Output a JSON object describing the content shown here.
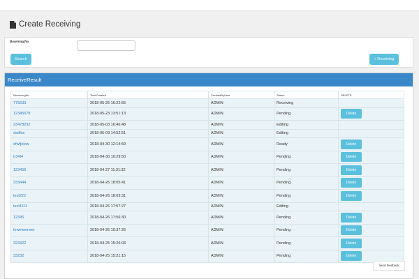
{
  "page": {
    "title": "Create Receiving",
    "icon": "document-icon"
  },
  "search": {
    "field_label": "ReceivingNo",
    "field_value": "",
    "search_label": "Search",
    "add_label": "+ Receiving"
  },
  "results": {
    "heading": "ReceiveResult",
    "columns": [
      "ReceivingNo",
      "TimeCreated",
      "CreatedByUser",
      "Status",
      "DELETE"
    ],
    "delete_label": "Delete",
    "rows": [
      {
        "receiving_no": "775633",
        "time_created": "2018-05-25 16:22:55",
        "created_by": "ADMIN",
        "status": "Receiving",
        "deletable": false
      },
      {
        "receiving_no": "12345678",
        "time_created": "2018-05-23 13:51:13",
        "created_by": "ADMIN",
        "status": "Pending",
        "deletable": true
      },
      {
        "receiving_no": "23478292",
        "time_created": "2018-05-03 16:46:48",
        "created_by": "ADMIN",
        "status": "Editing",
        "deletable": false
      },
      {
        "receiving_no": "dsdfds",
        "time_created": "2018-05-03 14:52:51",
        "created_by": "ADMIN",
        "status": "Editing",
        "deletable": false
      },
      {
        "receiving_no": "efwfjoiow",
        "time_created": "2018-04-30 12:14:59",
        "created_by": "ADMIN",
        "status": "Ready",
        "deletable": true
      },
      {
        "receiving_no": "tr34t4",
        "time_created": "2018-04-30 10:29:50",
        "created_by": "ADMIN",
        "status": "Pending",
        "deletable": true
      },
      {
        "receiving_no": "123456",
        "time_created": "2018-04-27 11:31:32",
        "created_by": "ADMIN",
        "status": "Pending",
        "deletable": true
      },
      {
        "receiving_no": "333444",
        "time_created": "2018-04-26 18:05:41",
        "created_by": "ADMIN",
        "status": "Pending",
        "deletable": true
      },
      {
        "receiving_no": "test222",
        "time_created": "2018-04-26 18:03:31",
        "created_by": "ADMIN",
        "status": "Pending",
        "deletable": true
      },
      {
        "receiving_no": "test1111",
        "time_created": "2018-04-26 17:57:27",
        "created_by": "ADMIN",
        "status": "Editing",
        "deletable": false
      },
      {
        "receiving_no": "12345",
        "time_created": "2018-04-26 17:56:30",
        "created_by": "ADMIN",
        "status": "Pending",
        "deletable": true
      },
      {
        "receiving_no": "tewetwerwer",
        "time_created": "2018-04-26 10:37:26",
        "created_by": "ADMIN",
        "status": "Pending",
        "deletable": true
      },
      {
        "receiving_no": "323322",
        "time_created": "2018-04-25 15:26:03",
        "created_by": "ADMIN",
        "status": "Pending",
        "deletable": true
      },
      {
        "receiving_no": "33232",
        "time_created": "2018-04-25 15:21:15",
        "created_by": "ADMIN",
        "status": "Pending",
        "deletable": true
      }
    ]
  },
  "feedback": {
    "label": "Send feedback"
  }
}
